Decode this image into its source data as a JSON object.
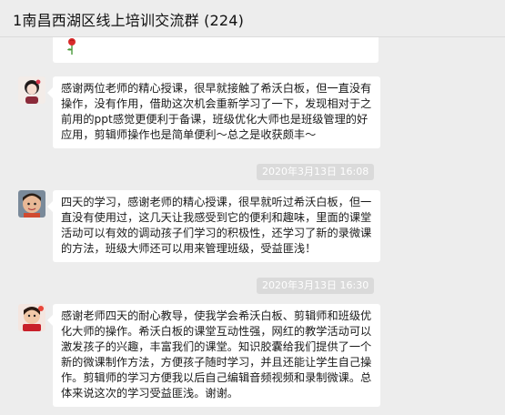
{
  "header": {
    "title": "1南昌西湖区线上培训交流群 (224)"
  },
  "messages": [
    {
      "text": ""
    },
    {
      "text": "感谢两位老师的精心授课，很早就接触了希沃白板，但一直没有操作，没有作用，借助这次机会重新学习了一下，发现相对于之前用的ppt感觉更便利于备课，班级优化大师也是班级管理的好应用，剪辑师操作也是简单便利～总之是收获颇丰～"
    },
    {
      "timestamp": "2020年3月13日 16:08"
    },
    {
      "text": "四天的学习，感谢老师的精心授课，很早就听过希沃白板，但一直没有使用过，这几天让我感受到它的便利和趣味，里面的课堂活动可以有效的调动孩子们学习的积极性，还学习了新的录微课的方法，班级大师还可以用来管理班级，受益匪浅！"
    },
    {
      "timestamp": "2020年3月13日 16:30"
    },
    {
      "text": "感谢老师四天的耐心教导，使我学会希沃白板、剪辑师和班级优化大师的操作。希沃白板的课堂互动性强，网红的教学活动可以激发孩子的兴趣，丰富我们的课堂。知识胶囊给我们提供了一个新的微课制作方法，方便孩子随时学习，并且还能让学生自己操作。剪辑师的学习方便我以后自己编辑音频视频和录制微课。总体来说这次的学习受益匪浅。谢谢。"
    }
  ],
  "colors": {
    "background": "#ededed",
    "bubble": "#ffffff",
    "timestamp_bg": "#dadada"
  }
}
